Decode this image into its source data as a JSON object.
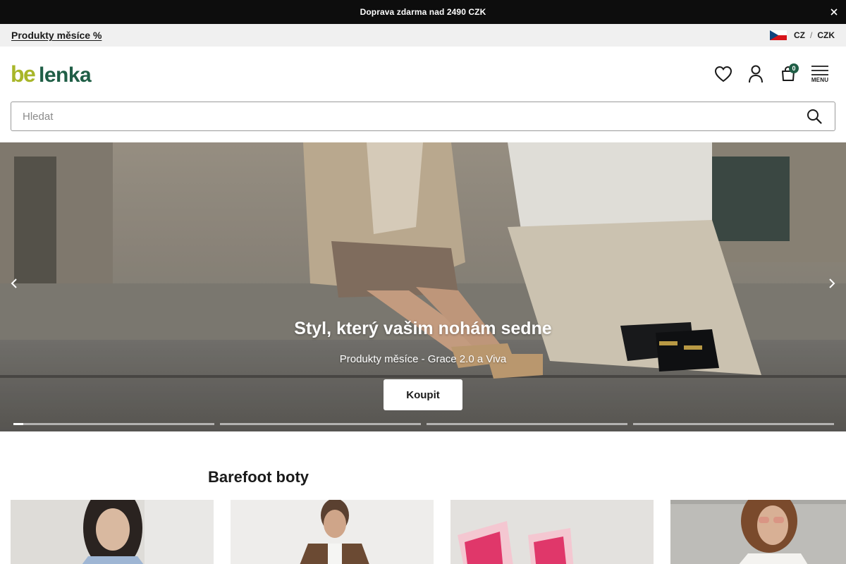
{
  "announcement": {
    "text": "Doprava zdarma nad 2490 CZK",
    "close_icon": "close-icon"
  },
  "subbar": {
    "promo_link": "Produkty měsíce %",
    "locale": {
      "language": "CZ",
      "separator": "/",
      "currency": "CZK",
      "flag_icon": "czech-flag-icon"
    }
  },
  "header": {
    "logo_text": "be lenka",
    "logo_colors": {
      "be": "#a8b629",
      "lenka": "#1f5e46"
    },
    "wishlist_icon": "heart-icon",
    "account_icon": "user-icon",
    "cart": {
      "icon": "shopping-bag-icon",
      "count": "0"
    },
    "menu": {
      "icon": "hamburger-icon",
      "label": "MENU"
    }
  },
  "search": {
    "placeholder": "Hledat",
    "value": "",
    "icon": "search-icon"
  },
  "hero": {
    "title": "Styl, který vašim nohám sedne",
    "subtitle": "Produkty měsíce - Grace 2.0 a Viva",
    "cta_label": "Koupit",
    "prev_icon": "chevron-left-icon",
    "next_icon": "chevron-right-icon",
    "slides_count": 4,
    "active_slide": 1,
    "active_progress": 0.05
  },
  "section": {
    "title": "Barefoot boty",
    "cards": [
      {
        "name": "card-women"
      },
      {
        "name": "card-men"
      },
      {
        "name": "card-kids"
      },
      {
        "name": "card-women-2"
      }
    ]
  }
}
